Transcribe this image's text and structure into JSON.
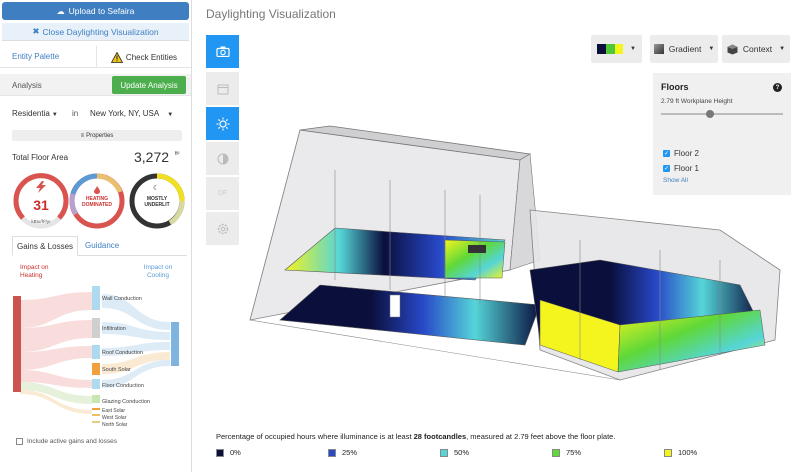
{
  "left_panel": {
    "upload_label": "Upload to Sefaira",
    "close_label": "Close Daylighting Visualization",
    "entity_palette": "Entity Palette",
    "check_entities": "Check Entities",
    "analysis_label": "Analysis",
    "update_analysis": "Update Analysis",
    "building_type": "Residentia",
    "in_label": "in",
    "location": "New York, NY, USA",
    "properties_label": "Properties",
    "total_floor_area_label": "Total Floor Area",
    "total_floor_area_value": "3,272",
    "total_floor_area_unit": "ft²",
    "gauges": {
      "eui_value": "31",
      "eui_unit": "kBtu/ft²/yr",
      "heating_line1": "HEATING",
      "heating_line2": "DOMINATED",
      "daylight_line1": "MOSTLY",
      "daylight_line2": "UNDERLIT"
    },
    "tabs": {
      "gains_losses": "Gains & Losses",
      "guidance": "Guidance"
    },
    "impact_heating": "Impact on Heating",
    "impact_cooling": "Impact on Cooling",
    "sankey_labels": [
      "Wall Conduction",
      "Infiltration",
      "Roof Conduction",
      "South Solar",
      "Floor Conduction",
      "Glazing Conduction",
      "East Solar",
      "West Solar",
      "North Solar"
    ],
    "include_active": "Include active gains and losses"
  },
  "right_panel": {
    "title": "Daylighting Visualization",
    "gradient_label": "Gradient",
    "context_label": "Context",
    "floors": {
      "title": "Floors",
      "help": "?",
      "workplane_height": "2.79 ft Workplane Height",
      "slider_level": 0.4,
      "items": [
        {
          "label": "Floor 2",
          "checked": true
        },
        {
          "label": "Floor 1",
          "checked": true
        }
      ],
      "show_all": "Show All"
    },
    "caption_pre": "Percentage of occupied hours where illuminance is at least ",
    "caption_bold": "28 footcandles",
    "caption_post": ", measured at 2.79 feet above the floor plate.",
    "legend": [
      {
        "label": "0%",
        "color": "#0a0f3c"
      },
      {
        "label": "25%",
        "color": "#2848c8"
      },
      {
        "label": "50%",
        "color": "#55d5d8"
      },
      {
        "label": "75%",
        "color": "#5fd838"
      },
      {
        "label": "100%",
        "color": "#f4f41e"
      }
    ]
  },
  "colors": {
    "accent_blue": "#2196f3",
    "upload_blue": "#3f7fc1",
    "update_green": "#4cae4c",
    "heating_red": "#c9302c",
    "cooling_blue": "#5b9bd5"
  }
}
